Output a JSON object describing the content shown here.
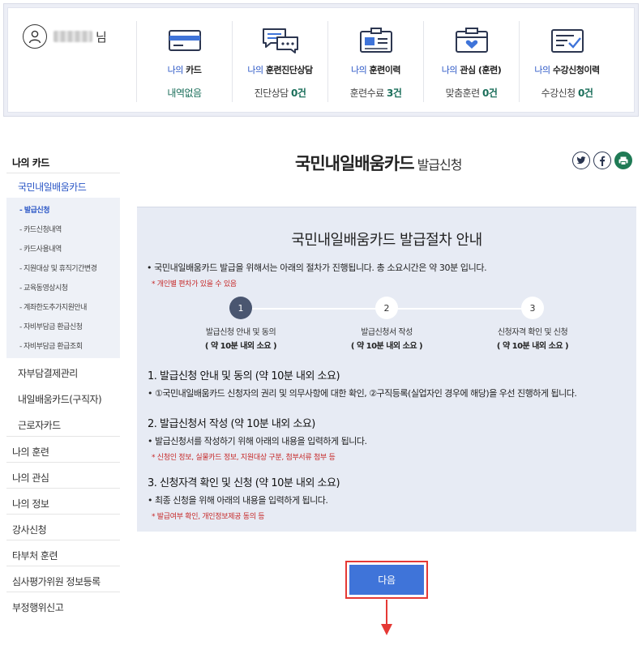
{
  "user": {
    "suffix": "님"
  },
  "summary": [
    {
      "prefix": "나의",
      "label": "카드",
      "value_text": "내역없음",
      "value_num": "",
      "icon": "card-icon"
    },
    {
      "prefix": "나의",
      "label": "훈련진단상담",
      "value_text": "진단상담 ",
      "value_num": "0건",
      "icon": "chat-icon"
    },
    {
      "prefix": "나의",
      "label": "훈련이력",
      "value_text": "훈련수료 ",
      "value_num": "3건",
      "icon": "id-card-icon"
    },
    {
      "prefix": "나의",
      "label": "관심 (훈련)",
      "value_text": "맞춤훈련 ",
      "value_num": "0건",
      "icon": "heart-folder-icon"
    },
    {
      "prefix": "나의",
      "label": "수강신청이력",
      "value_text": "수강신청 ",
      "value_num": "0건",
      "icon": "check-form-icon"
    }
  ],
  "lnb": {
    "top": "나의 카드",
    "sub_active": "국민내일배움카드",
    "leaves": [
      "- 발급신청",
      "- 카드신청내역",
      "- 카드사용내역",
      "- 지원대상 및 휴직기간변경",
      "- 교육동영상시청",
      "- 계좌한도추가지원안내",
      "- 자비부담금 환급신청",
      "- 자비부담금 환급조회"
    ],
    "subs": [
      "자부담결제관리",
      "내일배움카드(구직자)",
      "근로자카드"
    ],
    "mains": [
      "나의 훈련",
      "나의 관심",
      "나의 정보",
      "강사신청",
      "타부처 훈련",
      "심사평가위원 정보등록",
      "부정행위신고"
    ]
  },
  "page": {
    "title": "국민내일배움카드",
    "subtitle": "발급신청"
  },
  "guide": {
    "title": "국민내일배움카드 발급절차 안내",
    "intro": "• 국민내일배움카드 발급을 위해서는 아래의 절차가 진행됩니다. 총 소요시간은 약 30분 입니다.",
    "note": "* 개인별 편차가 있을 수 있음",
    "steps": [
      {
        "num": "1",
        "name": "발급신청 안내 및 동의",
        "time": "( 약 10분 내외 소요 )"
      },
      {
        "num": "2",
        "name": "발급신청서 작성",
        "time": "( 약 10분 내외 소요 )"
      },
      {
        "num": "3",
        "name": "신청자격 확인 및 신청",
        "time": "( 약 10분 내외 소요 )"
      }
    ],
    "sections": [
      {
        "title": "1. 발급신청 안내 및 동의 (약 10분 내외 소요)",
        "desc": "• ①국민내일배움카드 신청자의 권리 및 의무사항에 대한 확인, ②구직등록(실업자인 경우에 해당)을 우선 진행하게 됩니다.",
        "note": ""
      },
      {
        "title": "2. 발급신청서 작성 (약 10분 내외 소요)",
        "desc": "• 발급신청서를 작성하기 위해 아래의 내용을 입력하게 됩니다.",
        "note": "* 신청인 정보, 실물카드 정보, 지원대상 구분, 첨부서류 첨부 등"
      },
      {
        "title": "3. 신청자격 확인 및 신청 (약 10분 내외 소요)",
        "desc": "• 최종 신청을 위해 아래의 내용을 입력하게 됩니다.",
        "note": "* 발급여부 확인, 개인정보제공 동의 등"
      }
    ]
  },
  "next_label": "다음",
  "colors": {
    "accent": "#3f74d9",
    "highlight": "#e53935",
    "count": "#1a6e5a",
    "link": "#2a56c6"
  }
}
